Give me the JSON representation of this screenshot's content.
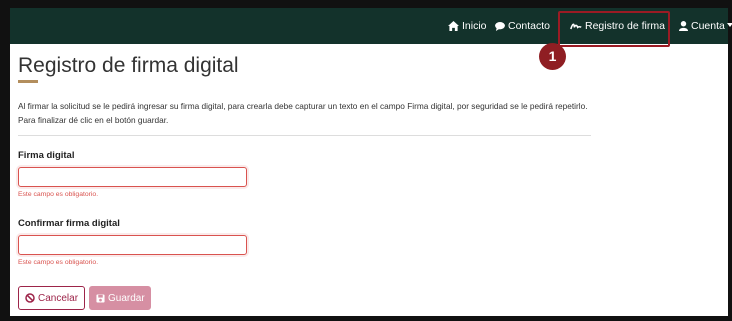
{
  "navbar": {
    "items": [
      {
        "label": "Inicio",
        "icon": "home-icon"
      },
      {
        "label": "Contacto",
        "icon": "chat-bubble-icon"
      },
      {
        "label": "Registro de firma",
        "icon": "signature-icon"
      },
      {
        "label": "Cuenta",
        "icon": "user-icon"
      }
    ],
    "background": "#13322b"
  },
  "annotation": {
    "step_number": "1",
    "color": "#8f1e23"
  },
  "page": {
    "title": "Registro de firma digital",
    "intro": "Al firmar la solicitud se le pedirá ingresar su firma digital, para crearla debe capturar un texto en el campo Firma digital, por seguridad se le pedirá repetirlo. Para finalizar dé clic en el botón guardar."
  },
  "form": {
    "firma": {
      "label": "Firma digital",
      "value": "",
      "error": "Este campo es obligatorio."
    },
    "confirmar": {
      "label": "Confirmar firma digital",
      "value": "",
      "error": "Este campo es obligatorio."
    },
    "cancel_label": "Cancelar",
    "save_label": "Guardar",
    "cancel_icon": "ban-icon",
    "save_icon": "floppy-disk-icon"
  },
  "colors": {
    "accent": "#9d2449",
    "error": "#d9534f",
    "title_underline": "#b38e5d"
  }
}
